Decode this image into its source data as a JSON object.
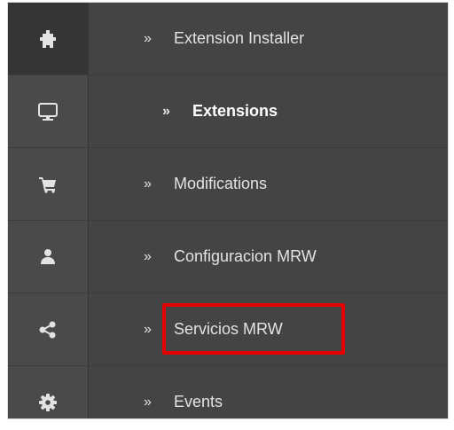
{
  "menu": {
    "items": [
      {
        "label": "Extension Installer",
        "icon": "puzzle-icon"
      },
      {
        "label": "Extensions",
        "icon": "monitor-icon"
      },
      {
        "label": "Modifications",
        "icon": "cart-icon"
      },
      {
        "label": "Configuracion MRW",
        "icon": "user-icon"
      },
      {
        "label": "Servicios MRW",
        "icon": "share-icon"
      },
      {
        "label": "Events",
        "icon": "gear-icon"
      }
    ],
    "chevron": "»"
  },
  "colors": {
    "sidebar_bg": "#444444",
    "icon_active_bg": "#353535",
    "icon_color": "#e3e3e3",
    "highlight_border": "#e60000"
  }
}
